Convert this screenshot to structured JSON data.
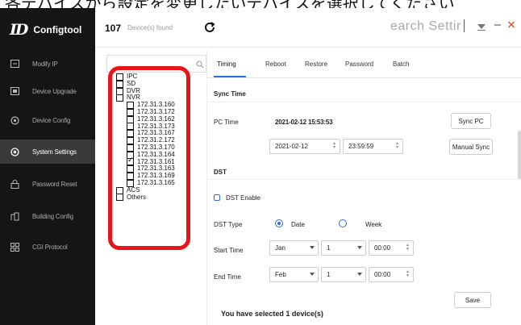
{
  "caption": {
    "text": "各デバイスから設定を変更したいデバイスを選択してください"
  },
  "app": {
    "logo_mark": "ID",
    "name": "Configtool"
  },
  "sidebar": {
    "items": [
      {
        "label": "Modify IP",
        "icon": "edit-ip-icon",
        "active": false
      },
      {
        "label": "Device Upgrade",
        "icon": "upgrade-icon",
        "active": false
      },
      {
        "label": "Device Config",
        "icon": "config-icon",
        "active": false
      },
      {
        "label": "System Settings",
        "icon": "system-settings-icon",
        "active": true
      },
      {
        "label": "Password Reset",
        "icon": "lock-icon",
        "active": false
      },
      {
        "label": "Building Config",
        "icon": "building-icon",
        "active": false
      },
      {
        "label": "CGI Protocol",
        "icon": "cgi-icon",
        "active": false
      }
    ]
  },
  "header": {
    "device_count": "107",
    "device_count_suffix": "Device(s) found",
    "search_text": "earch Settir",
    "refresh_icon": "refresh-icon",
    "filter_icon": "filter-icon",
    "minimize_icon": "minimize-icon",
    "close_icon": "close-icon"
  },
  "tree": {
    "nodes": [
      {
        "label": "IPC",
        "level": 0,
        "checked": false
      },
      {
        "label": "SD",
        "level": 0,
        "checked": false
      },
      {
        "label": "DVR",
        "level": 0,
        "checked": false
      },
      {
        "label": "NVR",
        "level": 0,
        "checked": false
      },
      {
        "label": "172.31.3.160",
        "level": 1,
        "checked": false
      },
      {
        "label": "172.31.3.172",
        "level": 1,
        "checked": false
      },
      {
        "label": "172.31.3.162",
        "level": 1,
        "checked": false
      },
      {
        "label": "172.31.3.173",
        "level": 1,
        "checked": false
      },
      {
        "label": "172.31.3.167",
        "level": 1,
        "checked": false
      },
      {
        "label": "172.31.2.172",
        "level": 1,
        "checked": false
      },
      {
        "label": "172.31.3.170",
        "level": 1,
        "checked": false
      },
      {
        "label": "172.31.3.164",
        "level": 1,
        "checked": false
      },
      {
        "label": "172.31.3.161",
        "level": 1,
        "checked": true
      },
      {
        "label": "172.31.3.163",
        "level": 1,
        "checked": false
      },
      {
        "label": "172.31.3.169",
        "level": 1,
        "checked": false
      },
      {
        "label": "172.31.3.165",
        "level": 1,
        "checked": false
      },
      {
        "label": "ACS",
        "level": 0,
        "checked": false
      },
      {
        "label": "Others",
        "level": 0,
        "checked": false
      }
    ],
    "highlight_color": "#e8141a"
  },
  "tabs": [
    "Timing",
    "Reboot",
    "Restore",
    "Password",
    "Batch"
  ],
  "sync": {
    "section_title": "Sync Time",
    "pc_time_label": "PC Time",
    "pc_time_value": "2021-02-12 15:53:53",
    "sync_pc_button": "Sync PC",
    "date_value": "2021-02-12",
    "time_value": "23:59:59",
    "manual_sync_button": "Manual Sync"
  },
  "dst": {
    "section_title": "DST",
    "enable_label": "DST Enable",
    "type_label": "DST Type",
    "type_options": [
      "Date",
      "Week"
    ],
    "type_selected": "Date",
    "start_label": "Start Time",
    "start_month": "Jan",
    "start_day": "1",
    "start_time": "00:00",
    "end_label": "End Time",
    "end_month": "Feb",
    "end_day": "1",
    "end_time": "00:00",
    "save_button": "Save"
  },
  "footer": {
    "selected_msg": "You have selected 1 device(s)"
  },
  "colors": {
    "accent": "#2f6fe0",
    "sidebar_bg": "#151515",
    "highlight_red": "#e8141a"
  }
}
